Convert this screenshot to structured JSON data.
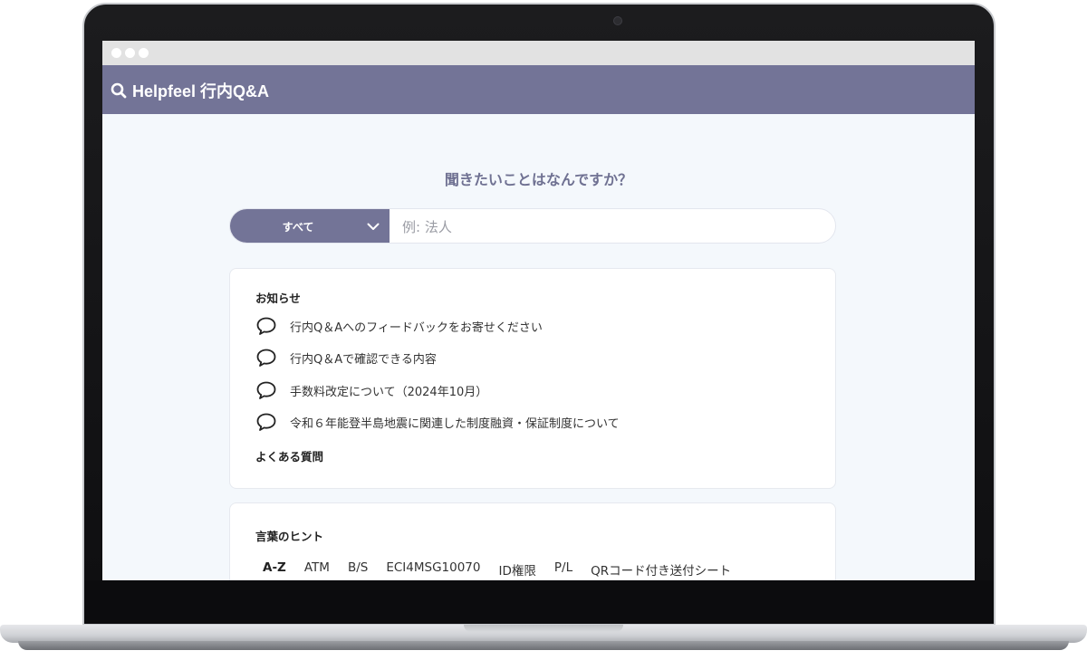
{
  "app": {
    "logo_text": "Helpfeel 行内Q&A"
  },
  "search": {
    "prompt": "聞きたいことはなんですか？",
    "category_selected": "すべて",
    "placeholder": "例: 法人"
  },
  "notices": {
    "title": "お知らせ",
    "items": [
      {
        "label": "行内Q＆Aへのフィードバックをお寄せください",
        "icon": "speech-bubble-icon"
      },
      {
        "label": "行内Q＆Aで確認できる内容",
        "icon": "speech-bubble-icon"
      },
      {
        "label": "手数料改定について（2024年10月）",
        "icon": "speech-bubble-icon"
      },
      {
        "label": "令和６年能登半島地震に関連した制度融資・保証制度について",
        "icon": "speech-bubble-icon"
      }
    ],
    "faq_heading": "よくある質問"
  },
  "hints": {
    "title": "言葉のヒント",
    "items": [
      "A-Z",
      "ATM",
      "B/S",
      "ECI4MSG10070",
      "ID権限",
      "P/L",
      "QRコード付き送付シート"
    ]
  },
  "colors": {
    "header_bg": "#737497",
    "page_bg": "#f4f8fc",
    "accent": "#737497"
  }
}
